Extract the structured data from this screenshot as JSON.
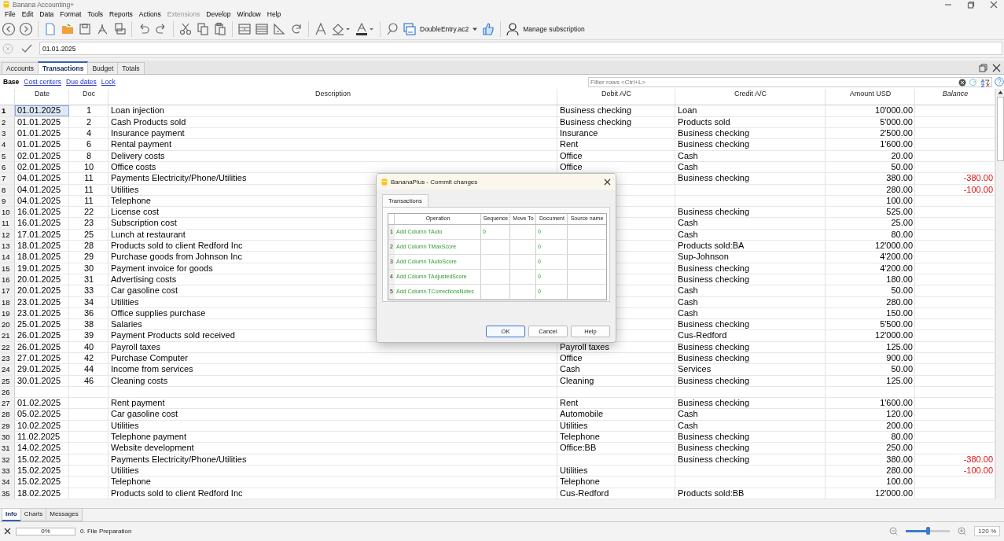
{
  "window": {
    "title": "Banana Accounting+"
  },
  "menu": [
    {
      "label": "File",
      "disabled": false
    },
    {
      "label": "Edit",
      "disabled": false
    },
    {
      "label": "Data",
      "disabled": false
    },
    {
      "label": "Format",
      "disabled": false
    },
    {
      "label": "Tools",
      "disabled": false
    },
    {
      "label": "Reports",
      "disabled": false
    },
    {
      "label": "Actions",
      "disabled": false
    },
    {
      "label": "Extensions",
      "disabled": true
    },
    {
      "label": "Develop",
      "disabled": false
    },
    {
      "label": "Window",
      "disabled": false
    },
    {
      "label": "Help",
      "disabled": false
    }
  ],
  "toolbar": {
    "file_name": "DoubleEntry.ac2",
    "subscription": "Manage subscription"
  },
  "formula_bar": {
    "value": "01.01.2025"
  },
  "tabs": [
    {
      "label": "Accounts",
      "selected": false
    },
    {
      "label": "Transactions",
      "selected": true
    },
    {
      "label": "Budget",
      "selected": false
    },
    {
      "label": "Totals",
      "selected": false
    }
  ],
  "views": [
    {
      "label": "Base",
      "selected": true
    },
    {
      "label": "Cost centers",
      "selected": false
    },
    {
      "label": "Due dates",
      "selected": false
    },
    {
      "label": "Lock",
      "selected": false
    }
  ],
  "filter": {
    "placeholder": "Filter rows <Ctrl+L>"
  },
  "table": {
    "columns": [
      "Date",
      "Doc",
      "Description",
      "Debit A/C",
      "Credit A/C",
      "Amount USD",
      "Balance"
    ],
    "rows": [
      {
        "num": "1",
        "selected": true,
        "date": "01.01.2025",
        "doc": "1",
        "description": "Loan injection",
        "debit": "Business checking",
        "credit": "Loan",
        "amount": "10'000.00"
      },
      {
        "num": "2",
        "selected": false,
        "date": "01.01.2025",
        "doc": "2",
        "description": "Cash Products sold",
        "debit": "Business checking",
        "credit": "Products sold",
        "amount": "5'000.00"
      },
      {
        "num": "3",
        "selected": false,
        "date": "01.01.2025",
        "doc": "4",
        "description": "Insurance payment",
        "debit": "Insurance",
        "credit": "Business checking",
        "amount": "2'500.00"
      },
      {
        "num": "4",
        "selected": false,
        "date": "01.01.2025",
        "doc": "6",
        "description": "Rental payment",
        "debit": "Rent",
        "credit": "Business checking",
        "amount": "1'600.00"
      },
      {
        "num": "5",
        "selected": false,
        "date": "02.01.2025",
        "doc": "8",
        "description": "Delivery costs",
        "debit": "Office",
        "credit": "Cash",
        "amount": "20.00"
      },
      {
        "num": "6",
        "selected": false,
        "date": "02.01.2025",
        "doc": "10",
        "description": "Office costs",
        "debit": "Office",
        "credit": "Cash",
        "amount": "50.00"
      },
      {
        "num": "7",
        "selected": false,
        "date": "04.01.2025",
        "doc": "11",
        "description": "Payments Electricity/Phone/Utilities",
        "credit": "Business checking",
        "amount": "380.00",
        "balance": "-380.00"
      },
      {
        "num": "8",
        "selected": false,
        "date": "04.01.2025",
        "doc": "11",
        "description": "Utilities",
        "amount": "280.00",
        "balance": "-100.00"
      },
      {
        "num": "9",
        "selected": false,
        "date": "04.01.2025",
        "doc": "11",
        "description": "Telephone",
        "amount": "100.00"
      },
      {
        "num": "10",
        "selected": false,
        "date": "16.01.2025",
        "doc": "22",
        "description": "License cost",
        "credit": "Business checking",
        "amount": "525.00"
      },
      {
        "num": "11",
        "selected": false,
        "date": "16.01.2025",
        "doc": "23",
        "description": "Subscription cost",
        "credit": "Cash",
        "amount": "25.00"
      },
      {
        "num": "12",
        "selected": false,
        "date": "17.01.2025",
        "doc": "25",
        "description": "Lunch at restaurant",
        "credit": "Cash",
        "amount": "80.00"
      },
      {
        "num": "13",
        "selected": false,
        "date": "18.01.2025",
        "doc": "28",
        "description": "Products sold to client Redford Inc",
        "credit": "Products sold:BA",
        "amount": "12'000.00"
      },
      {
        "num": "14",
        "selected": false,
        "date": "18.01.2025",
        "doc": "29",
        "description": "Purchase goods from Johnson Inc",
        "credit": "Sup-Johnson",
        "amount": "4'200.00"
      },
      {
        "num": "15",
        "selected": false,
        "date": "19.01.2025",
        "doc": "30",
        "description": "Payment invoice for goods",
        "credit": "Business checking",
        "amount": "4'200.00"
      },
      {
        "num": "16",
        "selected": false,
        "date": "20.01.2025",
        "doc": "31",
        "description": "Advertising costs",
        "credit": "Business checking",
        "amount": "180.00"
      },
      {
        "num": "17",
        "selected": false,
        "date": "20.01.2025",
        "doc": "33",
        "description": "Car gasoline cost",
        "credit": "Cash",
        "amount": "50.00"
      },
      {
        "num": "18",
        "selected": false,
        "date": "23.01.2025",
        "doc": "34",
        "description": "Utilities",
        "credit": "Cash",
        "amount": "280.00"
      },
      {
        "num": "19",
        "selected": false,
        "date": "23.01.2025",
        "doc": "36",
        "description": "Office supplies purchase",
        "credit": "Cash",
        "amount": "150.00"
      },
      {
        "num": "20",
        "selected": false,
        "date": "25.01.2025",
        "doc": "38",
        "description": "Salaries",
        "credit": "Business checking",
        "amount": "5'500.00"
      },
      {
        "num": "21",
        "selected": false,
        "date": "26.01.2025",
        "doc": "39",
        "description": "Payment Products sold received",
        "credit": "Cus-Redford",
        "amount": "12'000.00"
      },
      {
        "num": "22",
        "selected": false,
        "date": "26.01.2025",
        "doc": "40",
        "description": "Payroll taxes",
        "debit": "Payroll taxes",
        "credit": "Business checking",
        "amount": "125.00"
      },
      {
        "num": "23",
        "selected": false,
        "date": "27.01.2025",
        "doc": "42",
        "description": "Purchase Computer",
        "debit": "Office",
        "credit": "Business checking",
        "amount": "900.00"
      },
      {
        "num": "24",
        "selected": false,
        "date": "29.01.2025",
        "doc": "44",
        "description": "Income from services",
        "debit": "Cash",
        "credit": "Services",
        "amount": "50.00"
      },
      {
        "num": "25",
        "selected": false,
        "date": "30.01.2025",
        "doc": "46",
        "description": "Cleaning costs",
        "debit": "Cleaning",
        "credit": "Business checking",
        "amount": "125.00"
      },
      {
        "num": "26",
        "selected": false
      },
      {
        "num": "27",
        "selected": false,
        "date": "01.02.2025",
        "description": "Rent payment",
        "debit": "Rent",
        "credit": "Business checking",
        "amount": "1'600.00"
      },
      {
        "num": "28",
        "selected": false,
        "date": "05.02.2025",
        "description": "Car gasoline cost",
        "debit": "Automobile",
        "credit": "Cash",
        "amount": "120.00"
      },
      {
        "num": "29",
        "selected": false,
        "date": "10.02.2025",
        "description": "Utilities",
        "debit": "Utilities",
        "credit": "Cash",
        "amount": "200.00"
      },
      {
        "num": "30",
        "selected": false,
        "date": "11.02.2025",
        "description": "Telephone payment",
        "debit": "Telephone",
        "credit": "Business checking",
        "amount": "80.00"
      },
      {
        "num": "31",
        "selected": false,
        "date": "14.02.2025",
        "description": "Website development",
        "debit": "Office:BB",
        "credit": "Business checking",
        "amount": "250.00"
      },
      {
        "num": "32",
        "selected": false,
        "date": "15.02.2025",
        "description": "Payments Electricity/Phone/Utilities",
        "credit": "Business checking",
        "amount": "380.00",
        "balance": "-380.00"
      },
      {
        "num": "33",
        "selected": false,
        "date": "15.02.2025",
        "description": "Utilities",
        "debit": "Utilities",
        "amount": "280.00",
        "balance": "-100.00"
      },
      {
        "num": "34",
        "selected": false,
        "date": "15.02.2025",
        "description": "Telephone",
        "debit": "Telephone",
        "amount": "100.00"
      },
      {
        "num": "35",
        "selected": false,
        "date": "18.02.2025",
        "description": "Products sold to client Redford Inc",
        "debit": "Cus-Redford",
        "credit": "Products sold:BB",
        "amount": "12'000.00"
      }
    ]
  },
  "dialog": {
    "title": "BananaPlus - Commit changes",
    "tabs": [
      {
        "label": "Transactions",
        "selected": true
      }
    ],
    "columns": [
      "Operation",
      "Sequence",
      "Move To",
      "Document",
      "Source name"
    ],
    "rows": [
      {
        "num": "1",
        "operation": "Add Column TAuto",
        "sequence": "0",
        "document": "0"
      },
      {
        "num": "2",
        "operation": "Add Column TMaxScore",
        "document": "0"
      },
      {
        "num": "3",
        "operation": "Add Column TAutoScore",
        "document": "0"
      },
      {
        "num": "4",
        "operation": "Add Column TAdjustedScore",
        "document": "0"
      },
      {
        "num": "5",
        "operation": "Add Column TCorrectionsNotes",
        "document": "0"
      }
    ],
    "buttons": [
      {
        "label": "OK",
        "default": true
      },
      {
        "label": "Cancel",
        "default": false
      },
      {
        "label": "Help",
        "default": false
      }
    ]
  },
  "bottom": {
    "tabs": [
      {
        "label": "Info",
        "selected": true
      },
      {
        "label": "Charts",
        "selected": false
      },
      {
        "label": "Messages",
        "selected": false
      }
    ],
    "progress": {
      "label": "0%",
      "level": 0
    },
    "status": "0. File Preparation",
    "zoom": {
      "label": "120 %",
      "level": 0.5
    }
  }
}
